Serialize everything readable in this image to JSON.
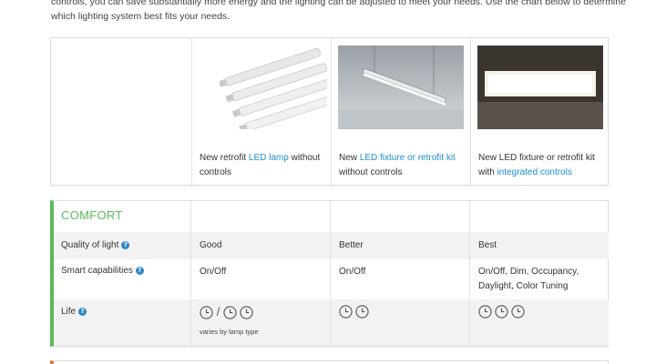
{
  "intro": {
    "text": "controls, you can save substantially more energy and the lighting can be adjusted to meet your needs. Use the chart below to determine which lighting system best fits your needs."
  },
  "products": [
    {
      "pre": "New retrofit ",
      "link": "LED lamp",
      "post": " without controls",
      "image": "led-tube-lamps-photo"
    },
    {
      "pre": "New ",
      "link": "LED fixture or retrofit kit",
      "post": " without controls",
      "image": "suspended-linear-fixture-photo"
    },
    {
      "pre": "New LED fixture or retrofit kit with ",
      "link": "integrated controls",
      "post": "",
      "image": "panel-fixture-photo"
    }
  ],
  "comfort": {
    "title": "COMFORT",
    "rows": [
      {
        "label": "Quality of light",
        "help": "?",
        "values": [
          "Good",
          "Better",
          "Best"
        ]
      },
      {
        "label": "Smart capabilities",
        "help": "?",
        "values": [
          "On/Off",
          "On/Off",
          "On/Off, Dim, Occupancy, Daylight, Color Tuning"
        ]
      },
      {
        "label": "Life",
        "help": "?",
        "clocks": [
          3,
          2,
          3
        ],
        "slash": "/",
        "note": "varies by lamp type"
      }
    ]
  },
  "colors": {
    "accent_green": "#5cb85c",
    "link_blue": "#1a8fd1",
    "help_blue": "#2f86c9",
    "next_section_orange": "#e07a33"
  }
}
